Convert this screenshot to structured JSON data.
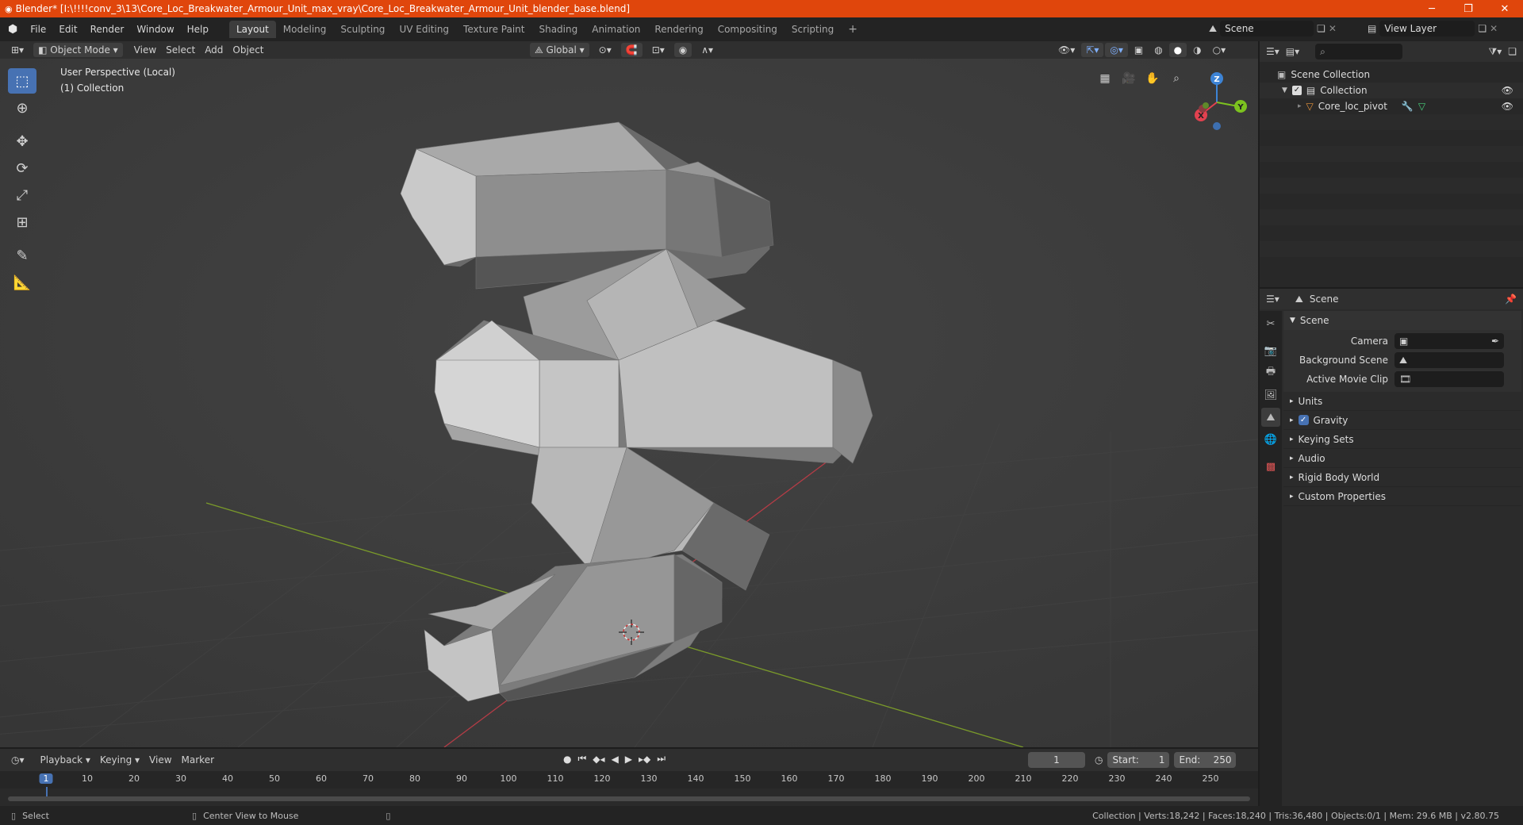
{
  "window": {
    "title": "Blender* [I:\\!!!!conv_3\\13\\Core_Loc_Breakwater_Armour_Unit_max_vray\\Core_Loc_Breakwater_Armour_Unit_blender_base.blend]",
    "minimize": "─",
    "maximize": "❐",
    "close": "✕"
  },
  "menus": [
    "File",
    "Edit",
    "Render",
    "Window",
    "Help"
  ],
  "workspaces": [
    "Layout",
    "Modeling",
    "Sculpting",
    "UV Editing",
    "Texture Paint",
    "Shading",
    "Animation",
    "Rendering",
    "Compositing",
    "Scripting"
  ],
  "add_workspace": "+",
  "scene_field": "Scene",
  "view_layer_field": "View Layer",
  "viewport_header": {
    "mode": "Object Mode",
    "menus": [
      "View",
      "Select",
      "Add",
      "Object"
    ],
    "transform_orientation": "Global"
  },
  "viewport": {
    "perspective_label": "User Perspective (Local)",
    "collection_label": "(1) Collection",
    "gizmo_axes": {
      "x": "X",
      "y": "Y",
      "z": "Z"
    }
  },
  "outliner": {
    "root": "Scene Collection",
    "collection": "Collection",
    "object": "Core_loc_pivot"
  },
  "properties": {
    "header": "Scene",
    "panel_title": "Scene",
    "fields": [
      {
        "label": "Camera",
        "value": ""
      },
      {
        "label": "Background Scene",
        "value": ""
      },
      {
        "label": "Active Movie Clip",
        "value": ""
      }
    ],
    "subpanels": [
      "Units",
      "Gravity",
      "Keying Sets",
      "Audio",
      "Rigid Body World",
      "Custom Properties"
    ]
  },
  "timeline": {
    "menus": [
      "Playback",
      "Keying",
      "View",
      "Marker"
    ],
    "current_frame": "1",
    "start_label": "Start:",
    "start_value": "1",
    "end_label": "End:",
    "end_value": "250",
    "ruler": [
      "1",
      "10",
      "20",
      "30",
      "40",
      "50",
      "60",
      "70",
      "80",
      "90",
      "100",
      "110",
      "120",
      "130",
      "140",
      "150",
      "160",
      "170",
      "180",
      "190",
      "200",
      "210",
      "220",
      "230",
      "240",
      "250"
    ]
  },
  "statusbar": {
    "left_action": "Select",
    "middle_action": "Center View to Mouse",
    "stats": "Collection | Verts:18,242 | Faces:18,240 | Tris:36,480 | Objects:0/1 | Mem: 29.6 MB | v2.80.75"
  },
  "colors": {
    "title_bar": "#e0460c",
    "accent": "#4772b3",
    "viewport_bg": "#3a3a3a",
    "x_axis": "#e2414f",
    "y_axis": "#7cc21f",
    "z_axis": "#3d84d6"
  }
}
